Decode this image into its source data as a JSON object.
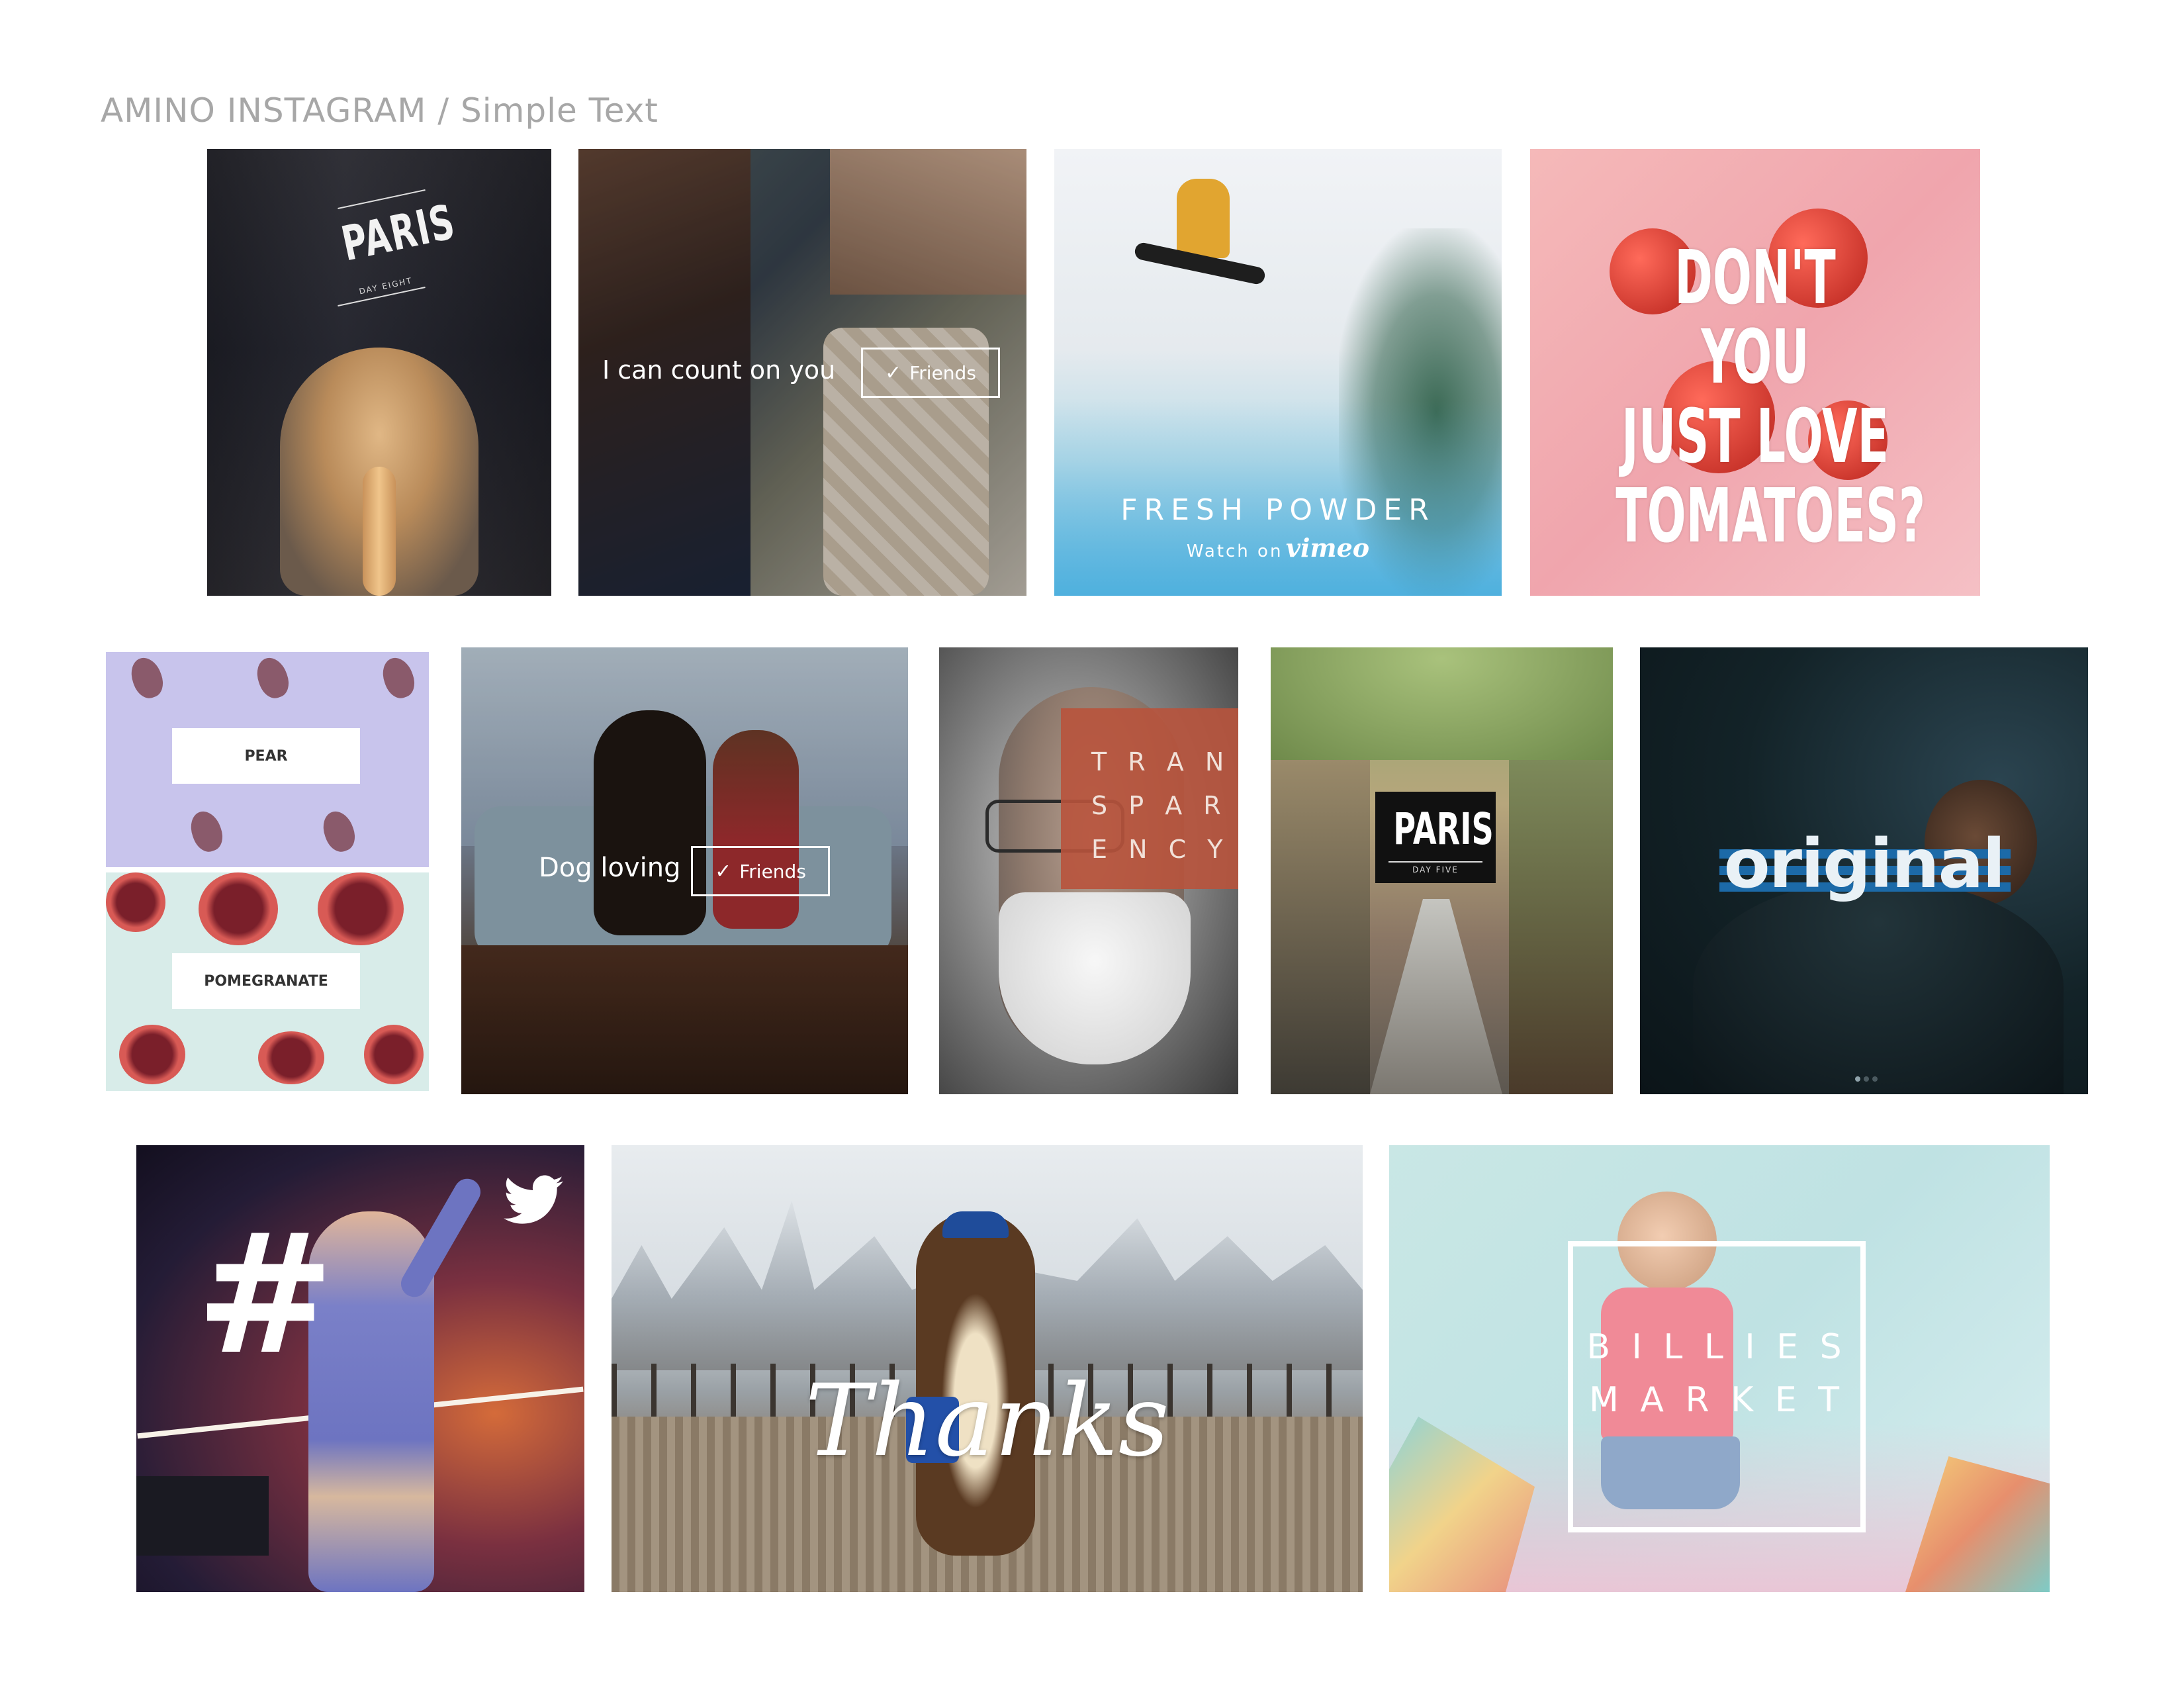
{
  "page": {
    "title": "AMINO INSTAGRAM / Simple Text"
  },
  "tiles": {
    "paris_day_eight": {
      "title": "PARIS",
      "subtitle": "DAY EIGHT"
    },
    "friends": {
      "caption": "I can count on you",
      "button_label": "Friends"
    },
    "fresh_powder": {
      "headline": "FRESH POWDER",
      "watch_on": "Watch on",
      "brand": "vimeo"
    },
    "tomatoes": {
      "line1": "DON'T YOU",
      "line2": "JUST LOVE",
      "line3": "TOMATOES?"
    },
    "pear": {
      "label": "PEAR"
    },
    "pomegranate": {
      "label": "POMEGRANATE"
    },
    "dog_loving": {
      "caption": "Dog loving",
      "button_label": "Friends"
    },
    "transparency": {
      "row1": "T R A N",
      "row2": "S P A R",
      "row3": "E N C Y"
    },
    "paris_day_five": {
      "title": "PARIS",
      "subtitle": "DAY FIVE"
    },
    "original": {
      "word": "original"
    },
    "hashtag": {
      "symbol": "#"
    },
    "thanks": {
      "word": "Thanks"
    },
    "billies_market": {
      "line1": "B I L L I E S",
      "line2": "M A R K E T"
    }
  },
  "icons": {
    "twitter": "twitter-bird-icon",
    "check": "check-icon"
  },
  "colors": {
    "title_gray": "#a7a7a7",
    "transparency_box": "#b8533c",
    "pear_bg": "#c8c4ec",
    "pomegranate_bg": "#d8ece9",
    "tomato_bg": "#f3b0b6"
  }
}
